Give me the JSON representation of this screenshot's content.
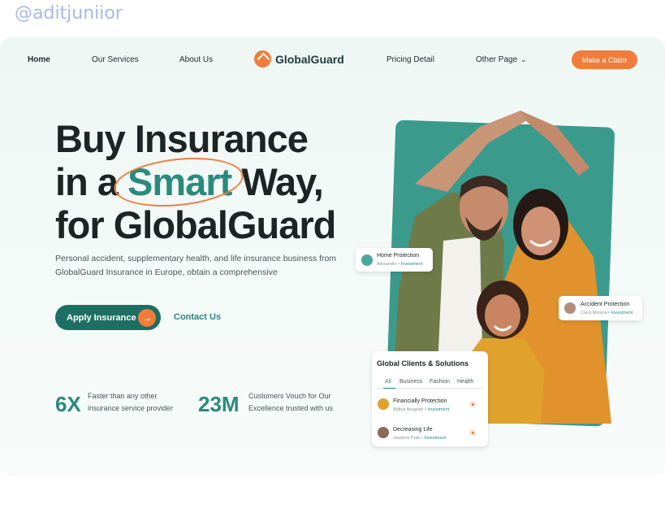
{
  "watermark": "@aditjuniior",
  "nav": {
    "home": "Home",
    "services": "Our Services",
    "about": "About Us",
    "brand": "GlobalGuard",
    "pricing": "Pricing Detail",
    "other": "Other Page",
    "claim": "Make a Claim"
  },
  "hero": {
    "line1": "Buy Insurance",
    "line2_pre": "in a ",
    "line2_smart": "Smart",
    "line2_post": " Way,",
    "line3": "for GlobalGuard",
    "description": "Personal accident, supplementary health, and life insurance business from GlobalGuard Insurance in Europe, obtain a comprehensive",
    "apply": "Apply Insurance",
    "contact": "Contact Us"
  },
  "stats": [
    {
      "num": "6X",
      "text": "Faster than any other insurance service provider"
    },
    {
      "num": "23M",
      "text": "Customers Vouch for Our Excellence trusted with us"
    }
  ],
  "cards": {
    "home": {
      "title": "Home Protection",
      "person": "Alexander",
      "tag": "Investment"
    },
    "accident": {
      "title": "Accident Protection",
      "person": "Clara Monica",
      "tag": "Investment"
    },
    "clients": {
      "title": "Global Clients & Solutions",
      "tabs": [
        "All",
        "Business",
        "Fashion",
        "Health"
      ],
      "rows": [
        {
          "title": "Financially Protection",
          "person": "Aditya Anugrah",
          "tag": "Investment"
        },
        {
          "title": "Decreasing Life",
          "person": "Jasmine Putri",
          "tag": "Investment"
        }
      ]
    }
  },
  "colors": {
    "accent": "#ef7d3b",
    "teal": "#2a8a7c",
    "dark_teal": "#1d6e63"
  }
}
